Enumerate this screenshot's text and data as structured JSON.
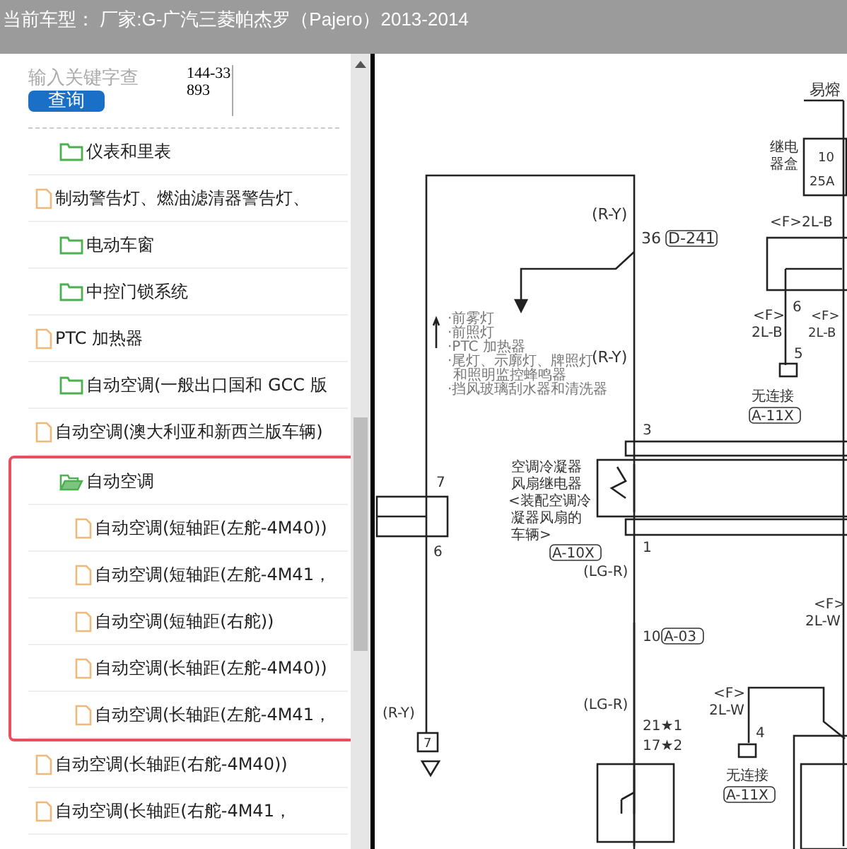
{
  "header": {
    "title": "当前车型： 厂家:G-广汽三菱帕杰罗（Pajero）2013-2014"
  },
  "search": {
    "placeholder": "输入关键字查",
    "button": "查询",
    "code": "144-33893"
  },
  "tree": [
    {
      "kind": "folder",
      "label": "仪表和里表",
      "expanded": false
    },
    {
      "kind": "file",
      "label": "制动警告灯、燃油滤清器警告灯、"
    },
    {
      "kind": "folder",
      "label": "电动车窗",
      "expanded": false
    },
    {
      "kind": "folder",
      "label": "中控门锁系统",
      "expanded": false
    },
    {
      "kind": "file",
      "label": "PTC 加热器"
    },
    {
      "kind": "folder",
      "label": "自动空调(一般出口国和 GCC 版",
      "expanded": false
    },
    {
      "kind": "file",
      "label": "自动空调(澳大利亚和新西兰版车辆)"
    },
    {
      "kind": "folder",
      "label": "自动空调",
      "expanded": true,
      "highlighted": true,
      "children": [
        {
          "kind": "file",
          "label": "自动空调(短轴距(左舵-4M40))"
        },
        {
          "kind": "file",
          "label": "自动空调(短轴距(左舵-4M41，"
        },
        {
          "kind": "file",
          "label": "自动空调(短轴距(右舵))"
        },
        {
          "kind": "file",
          "label": "自动空调(长轴距(左舵-4M40))"
        },
        {
          "kind": "file",
          "label": "自动空调(长轴距(左舵-4M41，"
        }
      ]
    },
    {
      "kind": "file",
      "label": "自动空调(长轴距(右舵-4M40))"
    },
    {
      "kind": "file",
      "label": "自动空调(长轴距(右舵-4M41，"
    }
  ],
  "diagram": {
    "labels": [
      "易熔",
      "继电",
      "器盒",
      "10",
      "25A",
      "<F>2L-B",
      "(R-Y)",
      "36",
      "D-241",
      "·前雾灯",
      "·前照灯",
      "·PTC 加热器",
      "·尾灯、示廓灯、牌照灯",
      "和照明监控蜂鸣器",
      "·挡风玻璃刮水器和清洗器",
      "(R-Y)",
      "6",
      "<F>",
      "2L-B",
      "<F>",
      "2L-B",
      "5",
      "无连接",
      "A-11X",
      "3",
      "7",
      "6",
      "空调冷凝器",
      "风扇继电器",
      "<装配空调冷",
      "凝器风扇的",
      "车辆>",
      "A-10X",
      "1",
      "(LG-R)",
      "10",
      "A-03",
      "<F>",
      "2L-W",
      "(LG-R)",
      "21★1",
      "17★2",
      "<F>",
      "2L-W",
      "4",
      "无连接",
      "A-11X",
      "(R-Y)",
      "7"
    ]
  }
}
